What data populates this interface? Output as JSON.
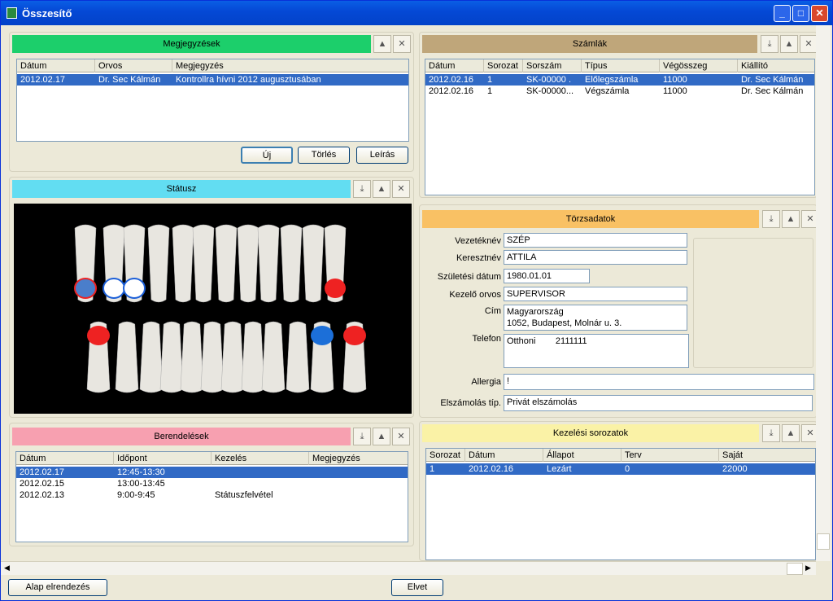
{
  "window": {
    "title": "Összesítő"
  },
  "notes": {
    "title": "Megjegyzések",
    "color": "#1ccf6b",
    "columns": [
      "Dátum",
      "Orvos",
      "Megjegyzés"
    ],
    "rows": [
      [
        "2012.02.17",
        "Dr. Sec Kálmán",
        "Kontrollra hívni 2012 augusztusában"
      ]
    ],
    "buttons": {
      "new": "Új",
      "delete": "Törlés",
      "description": "Leírás"
    }
  },
  "invoices": {
    "title": "Számlák",
    "color": "#bfa67a",
    "columns": [
      "Dátum",
      "Sorozat",
      "Sorszám",
      "Típus",
      "Végösszeg",
      "Kiállító"
    ],
    "rows": [
      [
        "2012.02.16",
        "1",
        "SK-00000 .",
        "Előlegszámla",
        "11000",
        "Dr. Sec Kálmán"
      ],
      [
        "2012.02.16",
        "1",
        "SK-00000...",
        "Végszámla",
        "11000",
        "Dr. Sec Kálmán"
      ]
    ]
  },
  "status": {
    "title": "Státusz",
    "color": "#62ddf2"
  },
  "master": {
    "title": "Törzsadatok",
    "color": "#f9c164",
    "labels": {
      "lastname": "Vezetéknév",
      "firstname": "Keresztnév",
      "birth": "Születési dátum",
      "doctor": "Kezelő orvos",
      "address": "Cím",
      "phone": "Telefon",
      "allergy": "Allergia",
      "billing": "Elszámolás típ."
    },
    "values": {
      "lastname": "SZÉP",
      "firstname": "ATTILA",
      "birth": "1980.01.01",
      "doctor": "SUPERVISOR",
      "address": "Magyarország\n1052, Budapest, Molnár u. 3.",
      "phone": "Otthoni        2111111",
      "allergy": "!",
      "billing": "Privát elszámolás"
    }
  },
  "appointments": {
    "title": "Berendelések",
    "color": "#f7a0b0",
    "columns": [
      "Dátum",
      "Időpont",
      "Kezelés",
      "Megjegyzés"
    ],
    "rows": [
      [
        "2012.02.17",
        "12:45-13:30",
        "",
        ""
      ],
      [
        "2012.02.15",
        "13:00-13:45",
        "",
        ""
      ],
      [
        "2012.02.13",
        "9:00-9:45",
        "Státuszfelvétel",
        ""
      ]
    ]
  },
  "treatments": {
    "title": "Kezelési sorozatok",
    "color": "#faf2a6",
    "columns": [
      "Sorozat",
      "Dátum",
      "Állapot",
      "Terv",
      "Saját"
    ],
    "rows": [
      [
        "1",
        "2012.02.16",
        "Lezárt",
        "0",
        "22000"
      ]
    ]
  },
  "footer": {
    "default_layout": "Alap elrendezés",
    "discard": "Elvet"
  },
  "icons": {
    "panel_buttons": [
      "export-icon",
      "collapse-icon",
      "close-icon"
    ]
  }
}
